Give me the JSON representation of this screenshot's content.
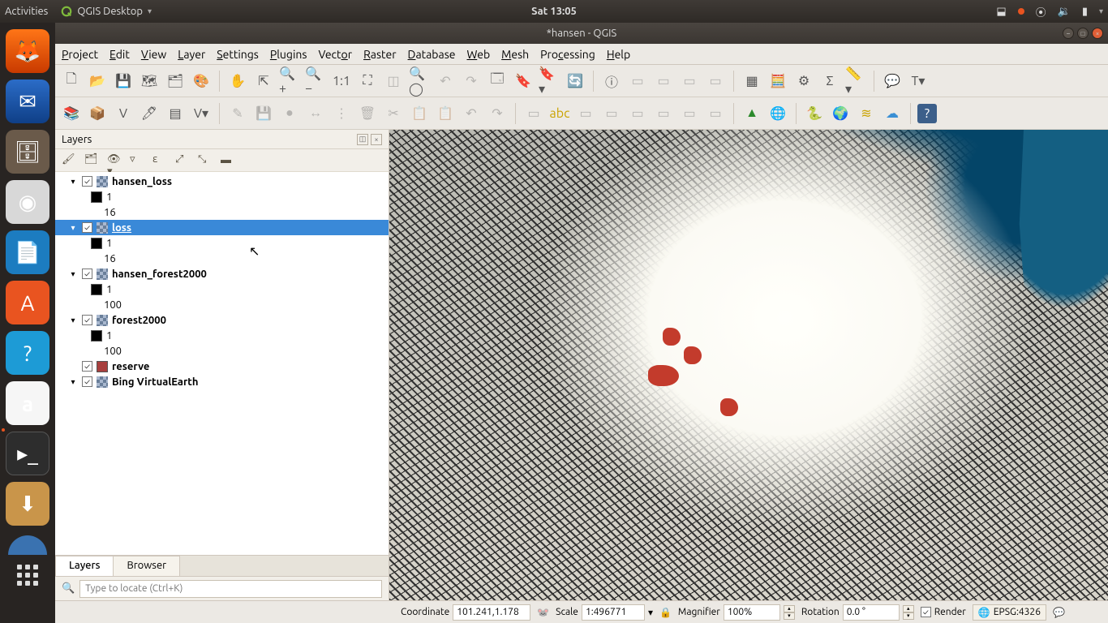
{
  "sysbar": {
    "activities": "Activities",
    "app_name": "QGIS Desktop",
    "clock": "Sat 13:05"
  },
  "window": {
    "title": "*hansen - QGIS"
  },
  "menu": {
    "project": "Project",
    "edit": "Edit",
    "view": "View",
    "layer": "Layer",
    "settings": "Settings",
    "plugins": "Plugins",
    "vector": "Vector",
    "raster": "Raster",
    "database": "Database",
    "web": "Web",
    "mesh": "Mesh",
    "processing": "Processing",
    "help": "Help"
  },
  "panel": {
    "title": "Layers",
    "tabs": {
      "layers": "Layers",
      "browser": "Browser"
    },
    "locator_placeholder": "Type to locate (Ctrl+K)",
    "layers": [
      {
        "name": "hansen_loss",
        "checked": true,
        "expanded": true,
        "selected": false,
        "type": "raster",
        "children": [
          {
            "swatch": "#000",
            "label": "1"
          },
          {
            "label": "16"
          }
        ]
      },
      {
        "name": "loss",
        "checked": true,
        "expanded": true,
        "selected": true,
        "type": "raster",
        "children": [
          {
            "swatch": "#000",
            "label": "1"
          },
          {
            "label": "16"
          }
        ]
      },
      {
        "name": "hansen_forest2000",
        "checked": true,
        "expanded": true,
        "selected": false,
        "type": "raster",
        "children": [
          {
            "swatch": "#000",
            "label": "1"
          },
          {
            "label": "100"
          }
        ]
      },
      {
        "name": "forest2000",
        "checked": true,
        "expanded": true,
        "selected": false,
        "type": "raster",
        "children": [
          {
            "swatch": "#000",
            "label": "1"
          },
          {
            "label": "100"
          }
        ]
      },
      {
        "name": "reserve",
        "checked": true,
        "expanded": false,
        "selected": false,
        "type": "vector",
        "swatch": "#a83f3e"
      },
      {
        "name": "Bing VirtualEarth",
        "checked": true,
        "expanded": true,
        "selected": false,
        "type": "raster"
      }
    ]
  },
  "status": {
    "coord_label": "Coordinate",
    "coord": "101.241,1.178",
    "scale_label": "Scale",
    "scale": "1:496771",
    "mag_label": "Magnifier",
    "mag": "100%",
    "rot_label": "Rotation",
    "rot": "0.0 °",
    "render_label": "Render",
    "crs": "EPSG:4326"
  }
}
